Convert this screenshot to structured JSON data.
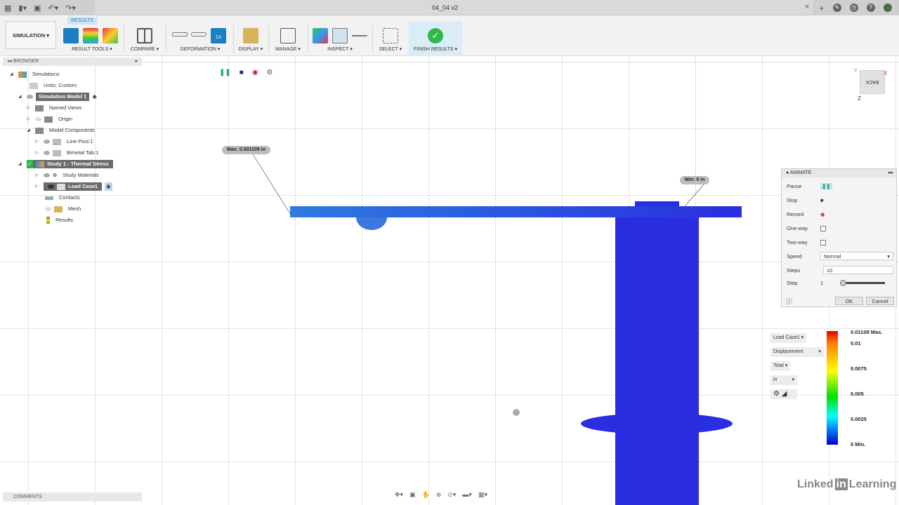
{
  "titlebar": {
    "document_title": "04_04 v2",
    "close": "×",
    "new_tab": "+"
  },
  "toolbar": {
    "workspace": "SIMULATION ▾",
    "active_tab": "RESULTS",
    "groups": [
      {
        "label": "RESULT TOOLS ▾"
      },
      {
        "label": "COMPARE ▾"
      },
      {
        "label": "DEFORMATION ▾"
      },
      {
        "label": "DISPLAY ▾"
      },
      {
        "label": "MANAGE ▾"
      },
      {
        "label": "INSPECT ▾"
      },
      {
        "label": "SELECT ▾"
      },
      {
        "label": "FINISH RESULTS ▾"
      }
    ],
    "deformation_scale_label": "1X"
  },
  "browser": {
    "title": "BROWSER",
    "items": [
      {
        "label": "Simulations"
      },
      {
        "label": "Units: Custom"
      },
      {
        "label": "Simulation Model 1"
      },
      {
        "label": "Named Views"
      },
      {
        "label": "Origin"
      },
      {
        "label": "Model Components"
      },
      {
        "label": "Line Post:1"
      },
      {
        "label": "Bimetal Tab:1"
      },
      {
        "label": "Study 1 - Thermal Stress"
      },
      {
        "label": "Study Materials"
      },
      {
        "label": "Load Case1"
      },
      {
        "label": "Contacts"
      },
      {
        "label": "Mesh"
      },
      {
        "label": "Results"
      }
    ]
  },
  "viewport": {
    "max_label": "Max: 0.001109 in",
    "min_label": "Min: 0 in",
    "viewcube": {
      "face": "BACK",
      "x": "X",
      "y": "Y",
      "z": "Z"
    }
  },
  "animate": {
    "title": "ANIMATE",
    "pause": "Pause",
    "stop": "Stop",
    "record": "Record",
    "one_way": "One-way",
    "two_way": "Two-way",
    "speed_label": "Speed",
    "speed_value": "Normal",
    "steps_label": "Steps",
    "steps_value": "10",
    "step_label": "Step",
    "step_value": "1",
    "ok": "OK",
    "cancel": "Cancel",
    "one_way_checked": false,
    "two_way_checked": false
  },
  "legend": {
    "load_case": "Load Case1 ▾",
    "result_type": "Displacement",
    "component": "Total ▾",
    "unit": "in",
    "ticks": [
      "0.01109 Max.",
      "0.01",
      "0.0075",
      "0.005",
      "0.0025",
      "0 Min."
    ],
    "colors": [
      "#e00000",
      "#ffff00",
      "#00e000",
      "#00ffff",
      "#0000c8"
    ]
  },
  "comments": {
    "title": "COMMENTS"
  },
  "branding": {
    "linkedin": "Linked",
    "in": "in",
    "learning": "Learning"
  },
  "colors": {
    "accent": "#1b7fc4",
    "model": "#2a2ee0",
    "finish": "#2fb84a"
  }
}
